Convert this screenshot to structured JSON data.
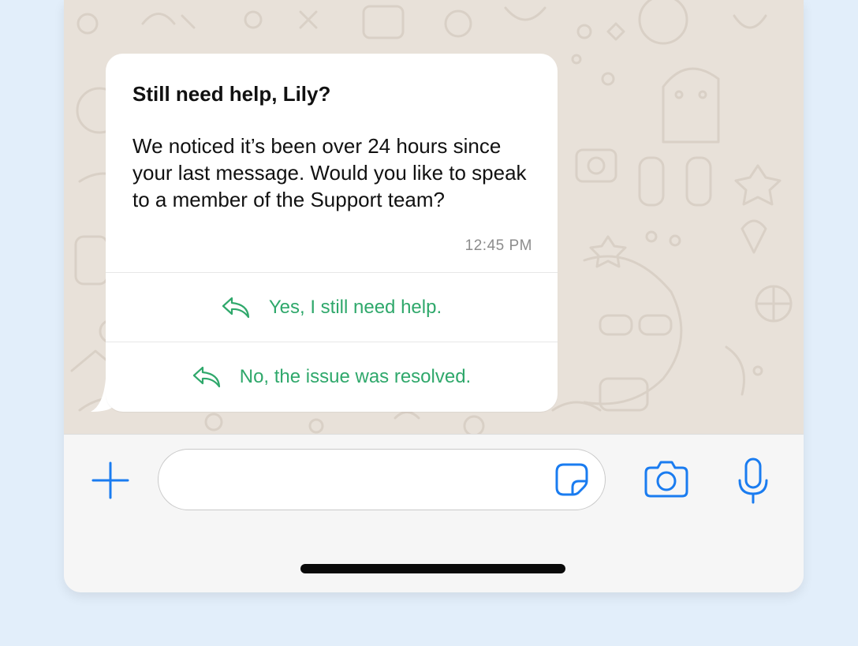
{
  "message": {
    "title": "Still need help, Lily?",
    "body": "We noticed it’s been over 24 hours since your last message. Would you like to speak to a member of the Support team?",
    "time": "12:45 PM"
  },
  "quick_replies": [
    {
      "label": "Yes, I still need help.",
      "icon": "reply-arrow-icon"
    },
    {
      "label": "No, the issue was resolved.",
      "icon": "reply-arrow-icon"
    }
  ],
  "composer": {
    "input_value": "",
    "icons": [
      "plus-icon",
      "sticker-icon",
      "camera-icon",
      "microphone-icon"
    ]
  },
  "colors": {
    "page_background": "#e2eefa",
    "chat_background": "#e8e1d9",
    "bubble": "#ffffff",
    "reply_green": "#2fa86b",
    "icon_blue": "#1a7cf0",
    "composer_background": "#f6f6f6"
  }
}
